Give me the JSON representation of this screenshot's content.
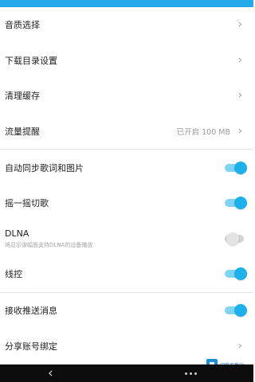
{
  "colors": {
    "accent": "#1eb0ea",
    "status_bar": "#24a9ea",
    "nav_bar": "#0c0c0c"
  },
  "settings": {
    "audio_quality": {
      "label": "音质选择"
    },
    "download_dir": {
      "label": "下载目录设置"
    },
    "clear_cache": {
      "label": "清理缓存"
    },
    "data_reminder": {
      "label": "流量提醒",
      "value": "已开启 100 MB"
    },
    "auto_sync": {
      "label": "自动同步歌词和图片",
      "enabled": true
    },
    "shake_switch": {
      "label": "摇一摇切歌",
      "enabled": true
    },
    "dlna": {
      "label": "DLNA",
      "sublabel": "将显示弹幅面支持DLNA的设备播放",
      "enabled": false
    },
    "wire_control": {
      "label": "线控",
      "enabled": true
    },
    "push_messages": {
      "label": "接收推送消息",
      "enabled": true
    },
    "share_account": {
      "label": "分享账号绑定"
    }
  },
  "watermark": {
    "text": "闪电下载站"
  },
  "icons": {
    "chevron": "chevron-right-icon",
    "back": "back-arrow-icon",
    "logo": "watermark-logo-icon"
  }
}
